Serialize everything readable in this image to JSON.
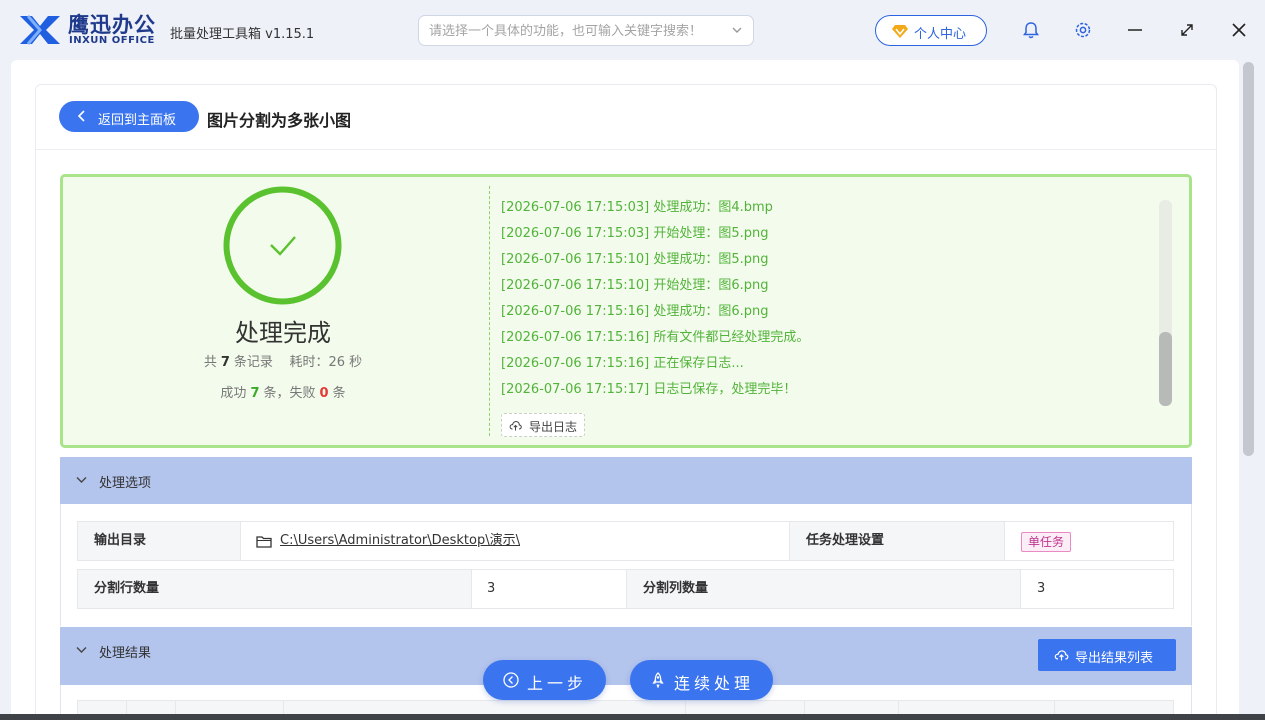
{
  "app": {
    "brand_cn": "鹰迅办公",
    "brand_en": "INXUN OFFICE",
    "title": "批量处理工具箱 v1.15.1",
    "search_placeholder": "请选择一个具体的功能，也可输入关键字搜索！",
    "user_center": "个人中心",
    "icons": [
      "logo-icon",
      "chevron-down-icon",
      "diamond-icon",
      "bell-icon",
      "gear-icon",
      "minimize-icon",
      "maximize-icon",
      "close-icon"
    ]
  },
  "page": {
    "back_label": "返回到主面板",
    "title": "图片分割为多张小图"
  },
  "result": {
    "status": "处理完成",
    "total_prefix": "共",
    "total": "7",
    "total_suffix": "条记录",
    "time_label": "耗时：",
    "time_value": "26",
    "time_unit": "秒",
    "success_prefix": "成功",
    "success_count": "7",
    "success_suffix": "条，失败",
    "fail_count": "0",
    "fail_suffix": "条",
    "colors": {
      "success": "#3aaa2a",
      "fail": "#e53935",
      "ring": "#5ac22e"
    }
  },
  "log": {
    "lines": [
      "[2026-07-06 17:15:03] 处理成功：图4.bmp",
      "[2026-07-06 17:15:03] 开始处理：图5.png",
      "[2026-07-06 17:15:10] 处理成功：图5.png",
      "[2026-07-06 17:15:10] 开始处理：图6.png",
      "[2026-07-06 17:15:16] 处理成功：图6.png",
      "[2026-07-06 17:15:16] 所有文件都已经处理完成。",
      "[2026-07-06 17:15:16] 正在保存日志...",
      "[2026-07-06 17:15:17] 日志已保存，处理完毕！"
    ],
    "export_label": "导出日志"
  },
  "options": {
    "section_title": "处理选项",
    "output_dir_label": "输出目录",
    "output_dir_value": "C:\\Users\\Administrator\\Desktop\\演示\\",
    "task_setting_label": "任务处理设置",
    "task_setting_value": "单任务",
    "rows_label": "分割行数量",
    "rows_value": "3",
    "cols_label": "分割列数量",
    "cols_value": "3"
  },
  "results": {
    "section_title": "处理结果",
    "export_label": "导出结果列表"
  },
  "actions": {
    "prev_label": "上一步",
    "continue_label": "连续处理"
  }
}
